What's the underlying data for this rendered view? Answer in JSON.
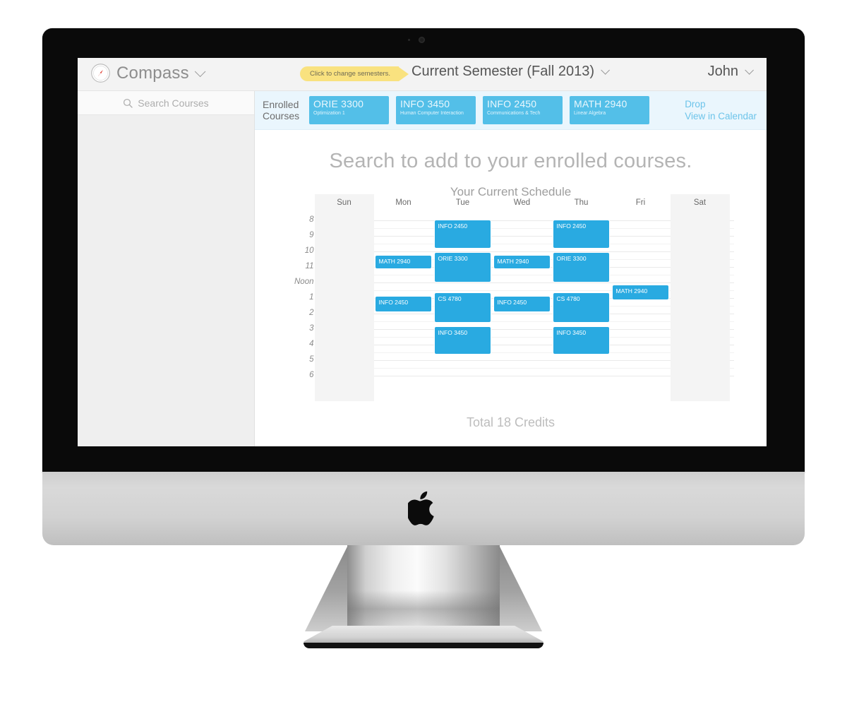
{
  "brand": {
    "name": "Compass",
    "icon": "compass-icon"
  },
  "topbar": {
    "callout": "Click to change semesters.",
    "semester": "Current Semester (Fall 2013)",
    "user": "John"
  },
  "sidebar": {
    "search_placeholder": "Search Courses",
    "search_icon": "search-icon"
  },
  "enrolled": {
    "label_line1": "Enrolled",
    "label_line2": "Courses",
    "courses": [
      {
        "code": "ORIE 3300",
        "title": "Optimization 1"
      },
      {
        "code": "INFO 3450",
        "title": "Human Computer Interaction"
      },
      {
        "code": "INFO 2450",
        "title": "Communications & Tech"
      },
      {
        "code": "MATH 2940",
        "title": "Linear Algebra"
      }
    ],
    "actions": [
      "Drop",
      "View in Calendar"
    ]
  },
  "main": {
    "headline": "Search to add to your enrolled courses.",
    "subhead": "Your Current Schedule",
    "credits": "Total 18 Credits"
  },
  "chart_data": {
    "type": "table",
    "title": "Your Current Schedule",
    "days": [
      "Sun",
      "Mon",
      "Tue",
      "Wed",
      "Thu",
      "Fri",
      "Sat"
    ],
    "weekend_days": [
      "Sun",
      "Sat"
    ],
    "time_labels": [
      "8",
      "9",
      "10",
      "11",
      "Noon",
      "1",
      "2",
      "3",
      "4",
      "5",
      "6"
    ],
    "axis_start_hour": 8,
    "axis_end_hour": 18,
    "events": [
      {
        "day": "Mon",
        "label": "MATH 2940",
        "start": 10.25,
        "end": 11.1
      },
      {
        "day": "Mon",
        "label": "INFO 2450",
        "start": 12.9,
        "end": 13.85
      },
      {
        "day": "Tue",
        "label": "INFO 2450",
        "start": 8.0,
        "end": 9.75
      },
      {
        "day": "Tue",
        "label": "ORIE 3300",
        "start": 10.1,
        "end": 11.95
      },
      {
        "day": "Tue",
        "label": "CS 4780",
        "start": 12.7,
        "end": 14.55
      },
      {
        "day": "Tue",
        "label": "INFO 3450",
        "start": 14.85,
        "end": 16.6
      },
      {
        "day": "Wed",
        "label": "MATH 2940",
        "start": 10.25,
        "end": 11.1
      },
      {
        "day": "Wed",
        "label": "INFO 2450",
        "start": 12.9,
        "end": 13.85
      },
      {
        "day": "Thu",
        "label": "INFO 2450",
        "start": 8.0,
        "end": 9.75
      },
      {
        "day": "Thu",
        "label": "ORIE 3300",
        "start": 10.1,
        "end": 11.95
      },
      {
        "day": "Thu",
        "label": "CS 4780",
        "start": 12.7,
        "end": 14.55
      },
      {
        "day": "Thu",
        "label": "INFO 3450",
        "start": 14.85,
        "end": 16.6
      },
      {
        "day": "Fri",
        "label": "MATH 2940",
        "start": 12.2,
        "end": 13.1
      }
    ]
  },
  "colors": {
    "event_blue": "#29aae1",
    "chip_blue": "#53bfe8",
    "strip_bg": "#eaf6fd",
    "callout_yellow": "#f9e27f",
    "link_blue": "#6dc4ea"
  }
}
